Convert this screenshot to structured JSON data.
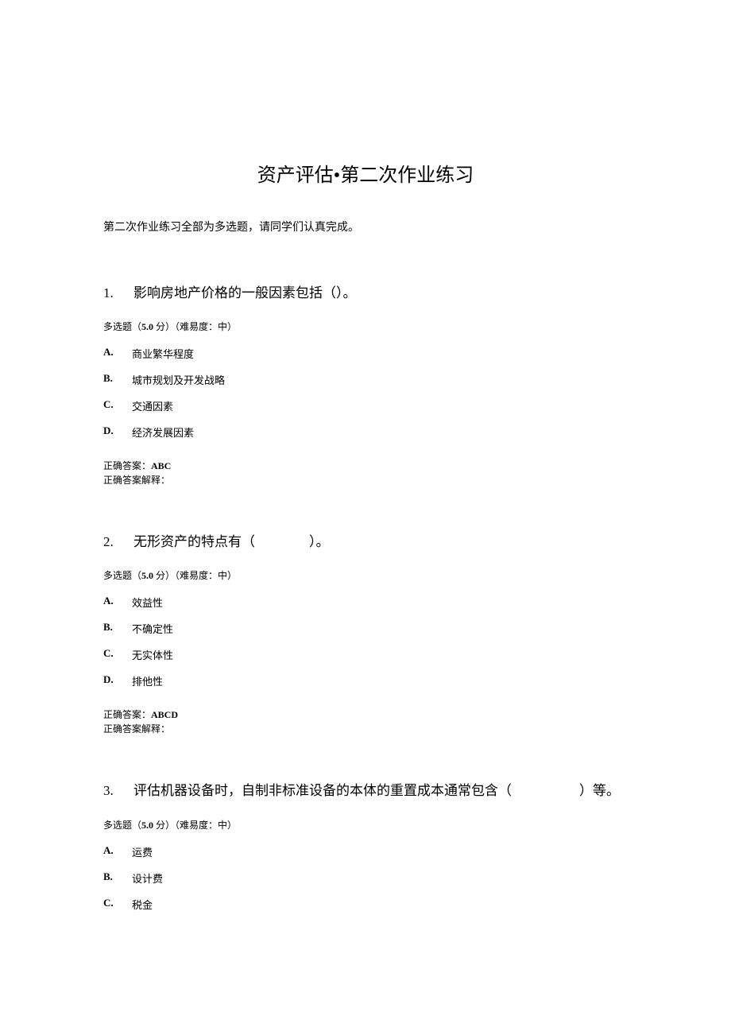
{
  "title": "资产评估•第二次作业练习",
  "intro": "第二次作业练习全部为多选题，请同学们认真完成。",
  "meta_template": {
    "prefix": "多选题（",
    "points": "5.0",
    "mid": " 分）（难易度：中）"
  },
  "answer_labels": {
    "correct_prefix": "正确答案：",
    "explain_prefix": "正确答案解释："
  },
  "questions": [
    {
      "num": "1.",
      "text": "影响房地产价格的一般因素包括（）。",
      "options": [
        {
          "label": "A.",
          "text": "商业繁华程度"
        },
        {
          "label": "B.",
          "text": "城市规划及开发战略"
        },
        {
          "label": "C.",
          "text": "交通因素"
        },
        {
          "label": "D.",
          "text": "经济发展因素"
        }
      ],
      "answer": "ABC",
      "explain": ""
    },
    {
      "num": "2.",
      "text": "无形资产的特点有（　　　　）。",
      "options": [
        {
          "label": "A.",
          "text": "效益性"
        },
        {
          "label": "B.",
          "text": "不确定性"
        },
        {
          "label": "C.",
          "text": "无实体性"
        },
        {
          "label": "D.",
          "text": "排他性"
        }
      ],
      "answer": "ABCD",
      "explain": ""
    },
    {
      "num": "3.",
      "text": "评估机器设备时，自制非标准设备的本体的重置成本通常包含（　　　　　）等。",
      "options": [
        {
          "label": "A.",
          "text": "运费"
        },
        {
          "label": "B.",
          "text": "设计费"
        },
        {
          "label": "C.",
          "text": "税金"
        }
      ],
      "answer": null,
      "explain": null
    }
  ]
}
